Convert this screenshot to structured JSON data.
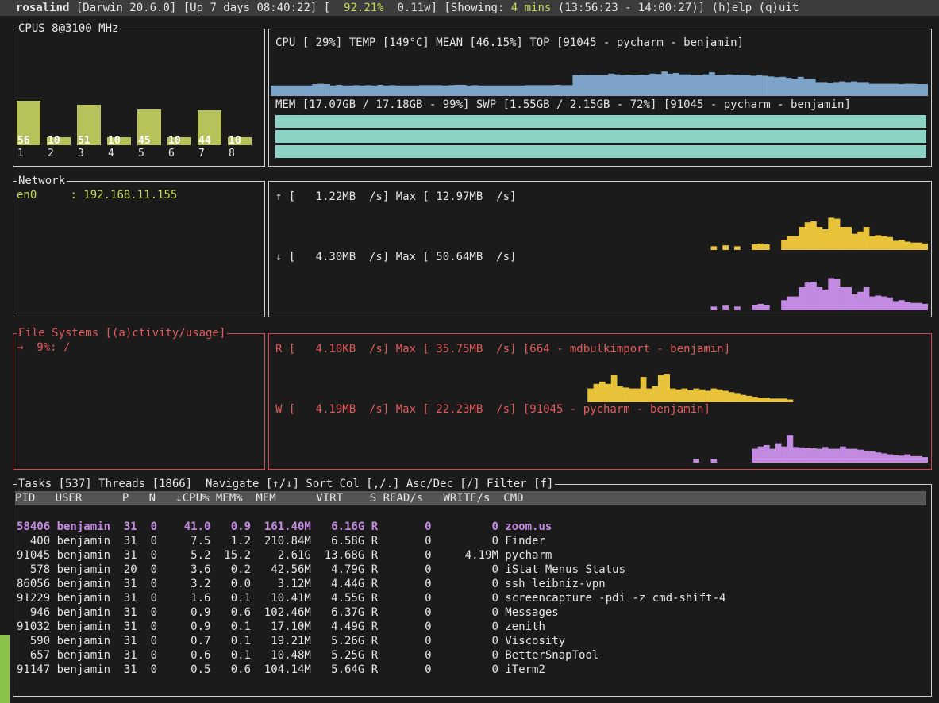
{
  "header": {
    "host": "rosalind",
    "os": " [Darwin 20.6.0]",
    "uptime": " [Up 7 days 08:40:22]",
    "bracket_open": " [  ",
    "battery": "92.21%",
    "power": "  0.11w]",
    "showing_prefix": " [Showing: ",
    "showing": "4 mins",
    "range": " (13:56:23 - 14:00:27)]",
    "help": " (h)elp",
    "quit": " (q)uit"
  },
  "cpus": {
    "title": "CPUS 8@3100 MHz",
    "cores": [
      {
        "label": "1",
        "value": 56
      },
      {
        "label": "2",
        "value": 10
      },
      {
        "label": "3",
        "value": 51
      },
      {
        "label": "4",
        "value": 10
      },
      {
        "label": "5",
        "value": 45
      },
      {
        "label": "6",
        "value": 10
      },
      {
        "label": "7",
        "value": 44
      },
      {
        "label": "8",
        "value": 10
      }
    ]
  },
  "cpu_summary": {
    "line": "CPU [ 29%] TEMP [149°C] MEAN [46.15%] TOP [91045 - pycharm - benjamin]",
    "history": [
      30,
      30,
      30,
      30,
      30,
      30,
      30,
      34,
      35,
      34,
      30,
      32,
      30,
      30,
      31,
      30,
      31,
      30,
      32,
      30,
      31,
      30,
      30,
      30,
      30,
      31,
      31,
      31,
      31,
      30,
      31,
      32,
      32,
      30,
      31,
      30,
      30,
      30,
      30,
      30,
      30,
      30,
      30,
      31,
      31,
      31,
      31,
      31,
      32,
      31,
      31,
      60,
      61,
      60,
      60,
      60,
      60,
      64,
      62,
      60,
      61,
      60,
      61,
      60,
      64,
      63,
      70,
      64,
      66,
      62,
      62,
      60,
      60,
      62,
      68,
      60,
      60,
      62,
      61,
      60,
      60,
      58,
      60,
      58,
      56,
      54,
      55,
      52,
      50,
      55,
      50,
      50,
      40,
      40,
      38,
      40,
      42,
      40,
      42,
      40,
      40,
      35,
      35,
      35,
      35,
      35,
      34,
      35,
      35,
      34,
      34
    ]
  },
  "mem": {
    "line": "MEM [17.07GB / 17.18GB - 99%] SWP [1.55GB / 2.15GB - 72%] [91045 - pycharm - benjamin]"
  },
  "network": {
    "title": "Network",
    "iface": "en0",
    "address": "     : 192.168.11.155",
    "up": "↑ [   1.22MB  /s] Max [ 12.97MB  /s]",
    "down": "↓ [   4.30MB  /s] Max [ 50.64MB  /s]",
    "up_history": [
      0,
      0,
      0,
      0,
      0,
      0,
      0,
      0,
      0,
      0,
      0,
      0,
      0,
      0,
      0,
      0,
      0,
      0,
      0,
      0,
      0,
      0,
      0,
      0,
      0,
      0,
      0,
      0,
      0,
      0,
      0,
      0,
      0,
      0,
      0,
      0,
      0,
      0,
      0,
      0,
      0,
      0,
      0,
      0,
      0,
      0,
      0,
      0,
      0,
      0,
      0,
      0,
      0,
      0,
      0,
      0,
      0,
      0,
      0,
      0,
      0,
      0,
      0,
      0,
      0,
      0,
      0,
      0,
      0,
      0,
      0,
      0,
      0,
      0,
      0,
      8,
      0,
      10,
      0,
      8,
      0,
      0,
      12,
      14,
      12,
      0,
      0,
      22,
      30,
      30,
      50,
      60,
      62,
      50,
      45,
      70,
      68,
      50,
      50,
      35,
      40,
      50,
      30,
      32,
      30,
      28,
      20,
      22,
      18,
      16,
      16,
      14
    ]
  },
  "filesystems": {
    "title": "File Systems [(a)ctivity/usage]",
    "entry": "→  9%: /",
    "read": "R [   4.10KB  /s] Max [ 35.75MB  /s] [664 - mdbulkimport - benjamin]",
    "write": "W [   4.19MB  /s] Max [ 22.23MB  /s] [91045 - pycharm - benjamin]",
    "read_history": [
      0,
      0,
      0,
      0,
      0,
      0,
      0,
      0,
      0,
      0,
      0,
      0,
      0,
      0,
      0,
      0,
      0,
      0,
      0,
      0,
      0,
      0,
      0,
      0,
      0,
      0,
      0,
      0,
      0,
      0,
      0,
      0,
      0,
      0,
      0,
      0,
      0,
      0,
      0,
      0,
      0,
      0,
      0,
      0,
      0,
      0,
      0,
      0,
      0,
      0,
      0,
      0,
      0,
      0,
      30,
      40,
      45,
      40,
      60,
      35,
      32,
      30,
      30,
      55,
      30,
      35,
      60,
      62,
      30,
      28,
      30,
      26,
      30,
      28,
      25,
      30,
      28,
      25,
      22,
      20,
      16,
      14,
      12,
      10,
      10,
      8,
      8,
      8,
      6,
      0,
      0,
      0,
      0,
      0,
      0,
      0,
      0,
      0,
      0,
      0,
      0,
      0,
      0,
      0,
      0,
      0,
      0,
      0,
      0,
      0,
      0,
      0
    ],
    "write_history": [
      0,
      0,
      0,
      0,
      0,
      0,
      0,
      0,
      0,
      0,
      0,
      0,
      0,
      0,
      0,
      0,
      0,
      0,
      0,
      0,
      0,
      0,
      0,
      0,
      0,
      0,
      0,
      0,
      0,
      0,
      0,
      0,
      0,
      0,
      0,
      0,
      0,
      0,
      0,
      0,
      0,
      0,
      0,
      0,
      0,
      0,
      0,
      0,
      0,
      0,
      0,
      0,
      0,
      0,
      0,
      0,
      0,
      0,
      0,
      0,
      0,
      0,
      0,
      0,
      0,
      0,
      0,
      0,
      0,
      0,
      0,
      0,
      8,
      0,
      0,
      8,
      0,
      0,
      0,
      0,
      0,
      0,
      30,
      35,
      38,
      30,
      42,
      35,
      60,
      34,
      33,
      32,
      31,
      30,
      34,
      30,
      30,
      35,
      30,
      30,
      28,
      26,
      25,
      22,
      20,
      18,
      16,
      15,
      18,
      14,
      14,
      12
    ]
  },
  "tasks": {
    "title": "Tasks [537] Threads [1866]  Navigate [↑/↓] Sort Col [,/.] Asc/Dec [/] Filter [f]",
    "header": "PID   USER      P   N   ↓CPU% MEM%  MEM      VIRT    S READ/s   WRITE/s  CMD",
    "rows": [
      "58406 benjamin  31  0    41.0   0.9  161.40M   6.16G R       0         0 zoom.us",
      "  400 benjamin  31  0     7.5   1.2  210.84M   6.58G R       0         0 Finder",
      "91045 benjamin  31  0     5.2  15.2    2.61G  13.68G R       0     4.19M pycharm",
      "  578 benjamin  20  0     3.6   0.2   42.56M   4.79G R       0         0 iStat Menus Status",
      "86056 benjamin  31  0     3.2   0.0    3.12M   4.44G R       0         0 ssh leibniz-vpn",
      "91229 benjamin  31  0     1.6   0.1   10.41M   4.55G R       0         0 screencapture -pdi -z cmd-shift-4",
      "  946 benjamin  31  0     0.9   0.6  102.46M   6.37G R       0         0 Messages",
      "91032 benjamin  31  0     0.9   0.1   17.10M   4.49G R       0         0 zenith",
      "  590 benjamin  31  0     0.7   0.1   19.21M   5.26G R       0         0 Viscosity",
      "  657 benjamin  31  0     0.6   0.1   10.48M   5.25G R       0         0 BetterSnapTool",
      "91147 benjamin  31  0     0.5   0.6  104.14M   5.64G R       0         0 iTerm2"
    ]
  },
  "colors": {
    "cpu_bar": "#b8c25a",
    "cpu_history": "#7ea3c8",
    "mem_bar": "#8cd3c5",
    "net_up": "#e8c33a",
    "net_down": "#c28ae0",
    "fs_read": "#e8c33a",
    "fs_write": "#c28ae0"
  }
}
